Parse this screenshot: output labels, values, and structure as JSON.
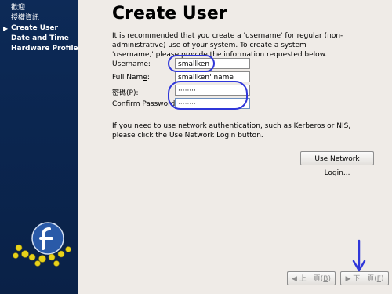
{
  "sidebar": {
    "items": [
      {
        "label": "歡迎",
        "active": false
      },
      {
        "label": "授權資訊",
        "active": false
      },
      {
        "label": "Create User",
        "active": true
      },
      {
        "label": "Date and Time",
        "active": false
      },
      {
        "label": "Hardware Profile",
        "active": false
      }
    ],
    "active_arrow": "▶"
  },
  "main": {
    "title": "Create User",
    "intro": "It is recommended that you create a 'username' for regular (non-administrative) use of your system. To create a system 'username,' please provide the information requested below.",
    "fields": {
      "username": {
        "label_pre": "",
        "label_u": "U",
        "label_post": "sername:",
        "value": "smallken"
      },
      "fullname": {
        "label_pre": "Full Nam",
        "label_u": "e",
        "label_post": ":",
        "value": "smallken' name"
      },
      "password": {
        "label_pre": "密碼(",
        "label_u": "P",
        "label_post": "):",
        "value": "········"
      },
      "confirm": {
        "label_pre": "Confir",
        "label_u": "m",
        "label_post": " Password:",
        "value": "········"
      }
    },
    "network_note": "If you need to use network authentication, such as Kerberos or NIS, please click the Use Network Login button.",
    "network_button": {
      "label_pre": "Use Network ",
      "label_u": "L",
      "label_post": "ogin..."
    }
  },
  "footer": {
    "back_button": {
      "label_pre": "上一頁(",
      "label_u": "B",
      "label_post": ")",
      "enabled": false
    },
    "next_button": {
      "label_pre": "下一頁(",
      "label_u": "F",
      "label_post": ")",
      "enabled": false
    }
  },
  "annotations": {
    "color": "#2f36d9"
  }
}
